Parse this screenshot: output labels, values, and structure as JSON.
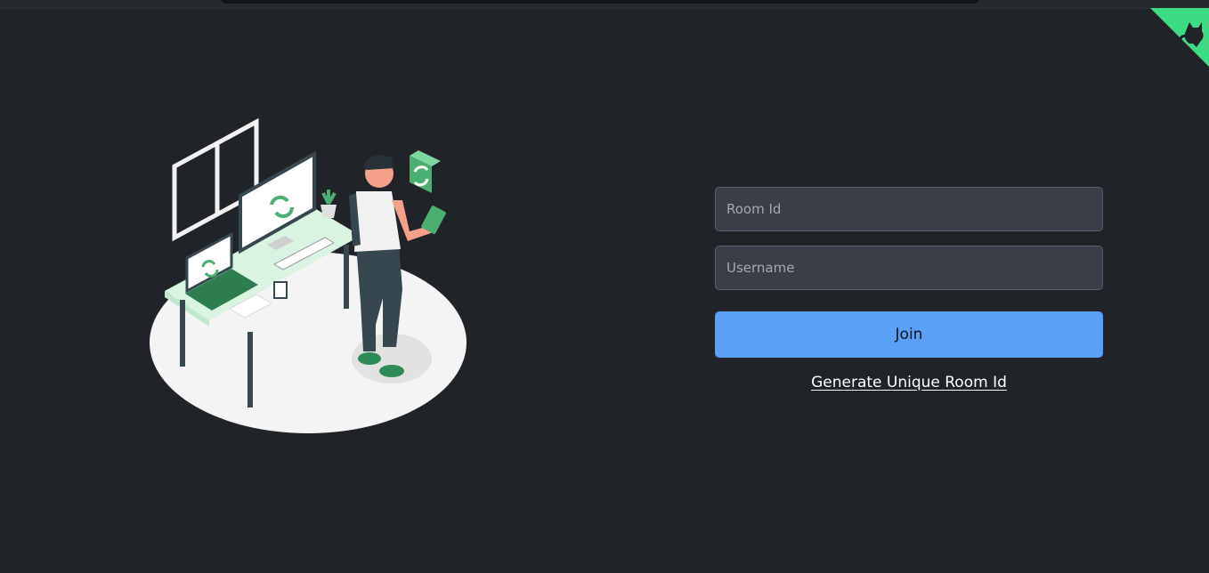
{
  "form": {
    "room_id_placeholder": "Room Id",
    "username_placeholder": "Username",
    "join_label": "Join",
    "generate_link": "Generate Unique Room Id"
  },
  "colors": {
    "background": "#202328",
    "input_bg": "#3b3e49",
    "button_bg": "#5ba0f7",
    "accent_green": "#3ddc84"
  },
  "icons": {
    "corner": "github-octocat-icon",
    "illustration": "workspace-illustration"
  }
}
